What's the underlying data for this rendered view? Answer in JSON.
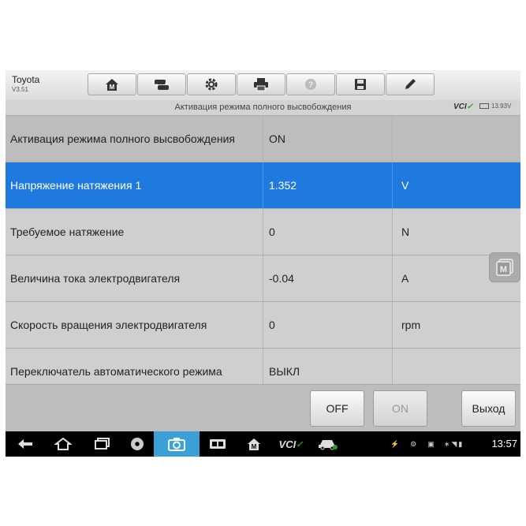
{
  "header": {
    "brand": "Toyota",
    "version": "V3.51",
    "toolbar": [
      {
        "name": "home-icon"
      },
      {
        "name": "vehicle-swap-icon"
      },
      {
        "name": "settings-gear-icon"
      },
      {
        "name": "print-icon"
      },
      {
        "name": "help-icon"
      },
      {
        "name": "save-icon"
      },
      {
        "name": "edit-pen-icon"
      }
    ]
  },
  "subbar": {
    "title": "Активация режима полного высвобождения",
    "vci_label": "VCI",
    "battery_voltage": "13.93V"
  },
  "rows": [
    {
      "name": "Активация режима полного высвобождения",
      "value": "ON",
      "unit": ""
    },
    {
      "name": "Напряжение натяжения 1",
      "value": "1.352",
      "unit": "V"
    },
    {
      "name": "Требуемое натяжение",
      "value": "0",
      "unit": "N"
    },
    {
      "name": "Величина тока электродвигателя",
      "value": "-0.04",
      "unit": "A"
    },
    {
      "name": "Скорость вращения электродвигателя",
      "value": "0",
      "unit": "rpm"
    },
    {
      "name": "Переключатель автоматического режима",
      "value": "ВЫКЛ",
      "unit": ""
    }
  ],
  "selected_row": 1,
  "buttons": {
    "off": "OFF",
    "on": "ON",
    "exit": "Выход"
  },
  "navbar": {
    "vci_label": "VCI",
    "time": "13:57"
  },
  "colors": {
    "selection": "#1f7ae0",
    "row_bg": "#cfcfcf",
    "header_row_bg": "#bdbdbd",
    "camera_highlight": "#3aa0d8"
  }
}
